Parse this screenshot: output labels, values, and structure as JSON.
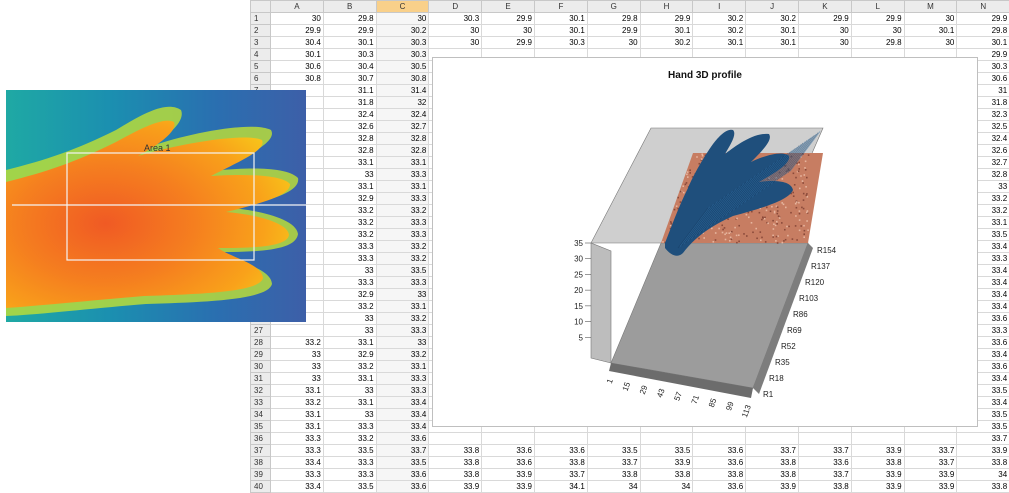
{
  "sheet": {
    "columns": [
      "A",
      "B",
      "C",
      "D",
      "E",
      "F",
      "G",
      "H",
      "I",
      "J",
      "K",
      "L",
      "M",
      "N"
    ],
    "selected_column": "C",
    "rows": [
      [
        "1",
        "30",
        "29.8",
        "30",
        "30.3",
        "29.9",
        "30.1",
        "29.8",
        "29.9",
        "30.2",
        "30.2",
        "29.9",
        "29.9",
        "30",
        "29.9"
      ],
      [
        "2",
        "29.9",
        "29.9",
        "30.2",
        "30",
        "30",
        "30.1",
        "29.9",
        "30.1",
        "30.2",
        "30.1",
        "30",
        "30",
        "30.1",
        "29.8"
      ],
      [
        "3",
        "30.4",
        "30.1",
        "30.3",
        "30",
        "29.9",
        "30.3",
        "30",
        "30.2",
        "30.1",
        "30.1",
        "30",
        "29.8",
        "30",
        "30.1"
      ],
      [
        "4",
        "30.1",
        "30.3",
        "30.3",
        "",
        "",
        "",
        "",
        "",
        "",
        "",
        "",
        "",
        "",
        "29.9"
      ],
      [
        "5",
        "30.6",
        "30.4",
        "30.5",
        "",
        "",
        "",
        "",
        "",
        "",
        "",
        "",
        "",
        "",
        "30.3"
      ],
      [
        "6",
        "30.8",
        "30.7",
        "30.8",
        "",
        "",
        "",
        "",
        "",
        "",
        "",
        "",
        "",
        "",
        "30.6"
      ],
      [
        "7",
        "",
        "31.1",
        "31.4",
        "",
        "",
        "",
        "",
        "",
        "",
        "",
        "",
        "",
        "",
        "31"
      ],
      [
        "8",
        "",
        "31.8",
        "32",
        "",
        "",
        "",
        "",
        "",
        "",
        "",
        "",
        "",
        "",
        "31.8"
      ],
      [
        "9",
        "",
        "32.4",
        "32.4",
        "",
        "",
        "",
        "",
        "",
        "",
        "",
        "",
        "",
        "",
        "32.3"
      ],
      [
        "10",
        "",
        "32.6",
        "32.7",
        "",
        "",
        "",
        "",
        "",
        "",
        "",
        "",
        "",
        "",
        "32.5"
      ],
      [
        "11",
        "",
        "32.8",
        "32.8",
        "",
        "",
        "",
        "",
        "",
        "",
        "",
        "",
        "",
        "",
        "32.4"
      ],
      [
        "12",
        "",
        "32.8",
        "32.8",
        "",
        "",
        "",
        "",
        "",
        "",
        "",
        "",
        "",
        "",
        "32.6"
      ],
      [
        "13",
        "",
        "33.1",
        "33.1",
        "",
        "",
        "",
        "",
        "",
        "",
        "",
        "",
        "",
        "",
        "32.7"
      ],
      [
        "14",
        "",
        "33",
        "33.3",
        "",
        "",
        "",
        "",
        "",
        "",
        "",
        "",
        "",
        "",
        "32.8"
      ],
      [
        "15",
        "",
        "33.1",
        "33.1",
        "",
        "",
        "",
        "",
        "",
        "",
        "",
        "",
        "",
        "",
        "33"
      ],
      [
        "16",
        "",
        "32.9",
        "33.3",
        "",
        "",
        "",
        "",
        "",
        "",
        "",
        "",
        "",
        "",
        "33.2"
      ],
      [
        "17",
        "",
        "33.2",
        "33.2",
        "",
        "",
        "",
        "",
        "",
        "",
        "",
        "",
        "",
        "",
        "33.2"
      ],
      [
        "18",
        "",
        "33.2",
        "33.3",
        "",
        "",
        "",
        "",
        "",
        "",
        "",
        "",
        "",
        "",
        "33.1"
      ],
      [
        "19",
        "",
        "33.2",
        "33.3",
        "",
        "",
        "",
        "",
        "",
        "",
        "",
        "",
        "",
        "",
        "33.5"
      ],
      [
        "20",
        "",
        "33.3",
        "33.2",
        "",
        "",
        "",
        "",
        "",
        "",
        "",
        "",
        "",
        "",
        "33.4"
      ],
      [
        "21",
        "",
        "33.3",
        "33.2",
        "",
        "",
        "",
        "",
        "",
        "",
        "",
        "",
        "",
        "",
        "33.3"
      ],
      [
        "22",
        "",
        "33",
        "33.5",
        "",
        "",
        "",
        "",
        "",
        "",
        "",
        "",
        "",
        "",
        "33.4"
      ],
      [
        "23",
        "",
        "33.3",
        "33.3",
        "",
        "",
        "",
        "",
        "",
        "",
        "",
        "",
        "",
        "",
        "33.4"
      ],
      [
        "24",
        "",
        "32.9",
        "33",
        "",
        "",
        "",
        "",
        "",
        "",
        "",
        "",
        "",
        "",
        "33.4"
      ],
      [
        "25",
        "",
        "33.2",
        "33.1",
        "",
        "",
        "",
        "",
        "",
        "",
        "",
        "",
        "",
        "",
        "33.4"
      ],
      [
        "26",
        "",
        "33",
        "33.2",
        "",
        "",
        "",
        "",
        "",
        "",
        "",
        "",
        "",
        "",
        "33.6"
      ],
      [
        "27",
        "",
        "33",
        "33.3",
        "",
        "",
        "",
        "",
        "",
        "",
        "",
        "",
        "",
        "",
        "33.3"
      ],
      [
        "28",
        "33.2",
        "33.1",
        "33",
        "",
        "",
        "",
        "",
        "",
        "",
        "",
        "",
        "",
        "",
        "33.6"
      ],
      [
        "29",
        "33",
        "32.9",
        "33.2",
        "",
        "",
        "",
        "",
        "",
        "",
        "",
        "",
        "",
        "",
        "33.4"
      ],
      [
        "30",
        "33",
        "33.2",
        "33.1",
        "",
        "",
        "",
        "",
        "",
        "",
        "",
        "",
        "",
        "",
        "33.6"
      ],
      [
        "31",
        "33",
        "33.1",
        "33.3",
        "",
        "",
        "",
        "",
        "",
        "",
        "",
        "",
        "",
        "",
        "33.4"
      ],
      [
        "32",
        "33.1",
        "33",
        "33.3",
        "",
        "",
        "",
        "",
        "",
        "",
        "",
        "",
        "",
        "",
        "33.5"
      ],
      [
        "33",
        "33.2",
        "33.1",
        "33.4",
        "",
        "",
        "",
        "",
        "",
        "",
        "",
        "",
        "",
        "",
        "33.4"
      ],
      [
        "34",
        "33.1",
        "33",
        "33.4",
        "",
        "",
        "",
        "",
        "",
        "",
        "",
        "",
        "",
        "",
        "33.5"
      ],
      [
        "35",
        "33.1",
        "33.3",
        "33.4",
        "",
        "",
        "",
        "",
        "",
        "",
        "",
        "",
        "",
        "",
        "33.5"
      ],
      [
        "36",
        "33.3",
        "33.2",
        "33.6",
        "",
        "",
        "",
        "",
        "",
        "",
        "",
        "",
        "",
        "",
        "33.7"
      ],
      [
        "37",
        "33.3",
        "33.5",
        "33.7",
        "33.8",
        "33.6",
        "33.6",
        "33.5",
        "33.5",
        "33.6",
        "33.7",
        "33.7",
        "33.9",
        "33.7",
        "33.9"
      ],
      [
        "38",
        "33.4",
        "33.3",
        "33.5",
        "33.8",
        "33.6",
        "33.8",
        "33.7",
        "33.9",
        "33.6",
        "33.8",
        "33.6",
        "33.8",
        "33.7",
        "33.8"
      ],
      [
        "39",
        "33.3",
        "33.3",
        "33.6",
        "33.8",
        "33.9",
        "33.7",
        "33.8",
        "33.8",
        "33.8",
        "33.8",
        "33.7",
        "33.9",
        "33.9",
        "34"
      ],
      [
        "40",
        "33.4",
        "33.5",
        "33.6",
        "33.9",
        "33.9",
        "34.1",
        "34",
        "34",
        "33.6",
        "33.9",
        "33.8",
        "33.9",
        "33.9",
        "33.8"
      ]
    ]
  },
  "thermal": {
    "area_label": "Area 1"
  },
  "chart_data": {
    "type": "surface",
    "title": "Hand 3D profile",
    "z_ticks": [
      "5",
      "10",
      "15",
      "20",
      "25",
      "30",
      "35"
    ],
    "x_ticks": [
      "1",
      "18",
      "35",
      "52",
      "69",
      "86",
      "103",
      "120",
      "137",
      "154"
    ],
    "x_tick_prefix": "R",
    "y_ticks": [
      "1",
      "15",
      "29",
      "43",
      "57",
      "71",
      "85",
      "99",
      "113"
    ]
  }
}
